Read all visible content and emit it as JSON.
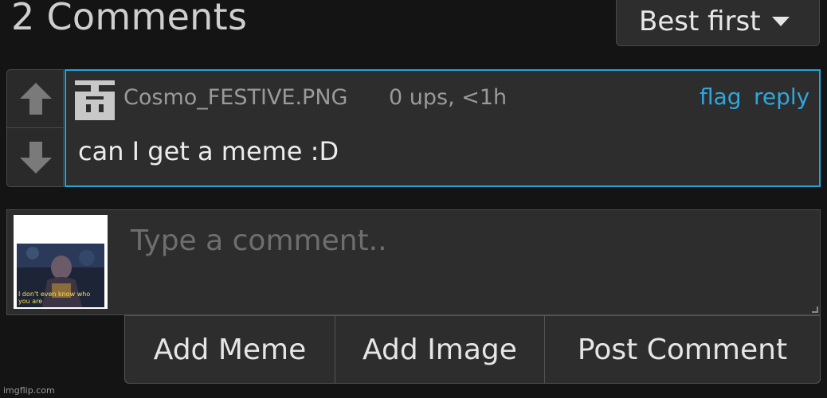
{
  "header": {
    "comment_count": "2 Comments",
    "sort_label": "Best first"
  },
  "comment": {
    "username": "Cosmo_FESTIVE.PNG",
    "meta": "0 ups, <1h",
    "flag_label": "flag",
    "reply_label": "reply",
    "text": "can I get a meme :D"
  },
  "compose": {
    "placeholder": "Type a comment..",
    "avatar_caption": "I don't even know who you are"
  },
  "buttons": {
    "add_meme": "Add Meme",
    "add_image": "Add Image",
    "post_comment": "Post Comment"
  },
  "watermark": "imgflip.com",
  "colors": {
    "accent": "#2fa7dd",
    "background": "#141414",
    "panel": "#2d2d2d"
  }
}
